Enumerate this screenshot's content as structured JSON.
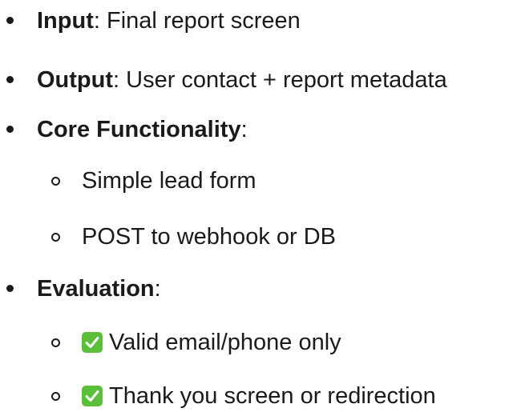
{
  "list": {
    "item1": {
      "label": "Input",
      "colon": ":",
      "text": " Final report screen"
    },
    "item2": {
      "label": "Output",
      "colon": ":",
      "text": " User contact + report metadata"
    },
    "item3": {
      "label": "Core Functionality",
      "colon": ":"
    },
    "item3_sub": [
      "Simple lead form",
      "POST to webhook or DB"
    ],
    "item4": {
      "label": "Evaluation",
      "colon": ":"
    },
    "item4_sub": [
      "Valid email/phone only",
      "Thank you screen or redirection"
    ]
  },
  "colors": {
    "text": "#1a1a1a",
    "check_bg": "#5bbf3a"
  },
  "icons": {
    "check": "check-mark-button-icon"
  }
}
